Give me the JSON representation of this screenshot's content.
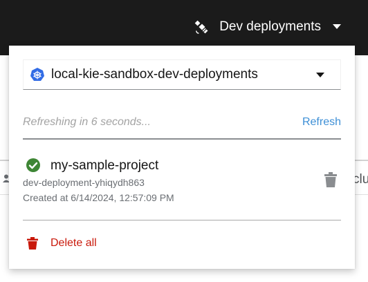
{
  "header": {
    "dev_deployments_label": "Dev deployments",
    "toggle_icon": "satellite-icon"
  },
  "namespace_select": {
    "value": "local-kie-sandbox-dev-deployments",
    "icon": "kubernetes-icon"
  },
  "refresh": {
    "status_text": "Refreshing in 6 seconds...",
    "button_label": "Refresh"
  },
  "deployment": {
    "name": "my-sample-project",
    "id": "dev-deployment-yhiqydh863",
    "created": "Created at 6/14/2024, 12:57:09 PM",
    "status_icon": "check-circle-icon",
    "status_color": "#3e8635"
  },
  "actions": {
    "delete_all_label": "Delete all",
    "delete_color": "#c9190b"
  },
  "background_fragments": {
    "right_text": "clu"
  },
  "colors": {
    "masthead": "#1b1b1b",
    "link": "#3d8fd6"
  }
}
